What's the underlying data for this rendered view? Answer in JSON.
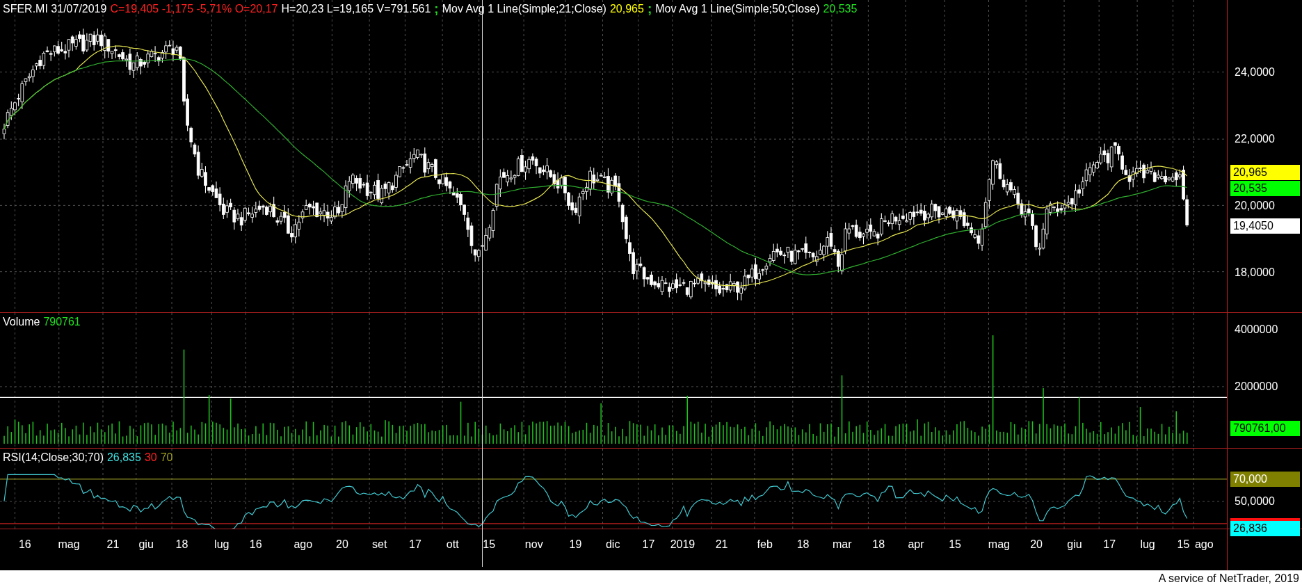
{
  "header": [
    {
      "text": "SFER.MI 31/07/2019",
      "color": "#ffffff"
    },
    {
      "text": "C=19,405 -1,175 -5,71% O=20,17",
      "color": "#ff2020"
    },
    {
      "text": "H=20,23 L=19,165 V=791.561",
      "color": "#ffffff"
    },
    {
      "text": ";",
      "color": "#20e020"
    },
    {
      "text": "Mov Avg 1 Line(Simple;21;Close)",
      "color": "#ffffff"
    },
    {
      "text": "20,965",
      "color": "#ffff00"
    },
    {
      "text": ";",
      "color": "#20e020"
    },
    {
      "text": "Mov Avg 1 Line(Simple;50;Close)",
      "color": "#ffffff"
    },
    {
      "text": "20,535",
      "color": "#20e020"
    }
  ],
  "price_axis": {
    "ticks": [
      "24,0000",
      "22,0000",
      "20,0000",
      "18,0000"
    ],
    "badges": [
      {
        "text": "20,965",
        "color": "#ffff00"
      },
      {
        "text": "20,535",
        "color": "#00ff00"
      },
      {
        "text": "19,4050",
        "color": "#ffffff"
      }
    ]
  },
  "volume_legend": [
    {
      "text": "Volume",
      "color": "#ffffff"
    },
    {
      "text": "790761",
      "color": "#20e020"
    }
  ],
  "volume_axis": {
    "ticks": [
      "4000000",
      "2000000"
    ],
    "badges": [
      {
        "text": "790761,00",
        "color": "#00ff00"
      }
    ]
  },
  "rsi_legend": [
    {
      "text": "RSI(14;Close;30;70)",
      "color": "#ffffff"
    },
    {
      "text": "26,835",
      "color": "#40e0e0"
    },
    {
      "text": "30",
      "color": "#ff2020"
    },
    {
      "text": "70",
      "color": "#a0a020"
    }
  ],
  "rsi_axis": {
    "ticks": [
      "50,0000"
    ],
    "badges": [
      {
        "text": "70,000",
        "color": "#808000"
      },
      {
        "text": "26,836",
        "color": "#00ffff"
      }
    ]
  },
  "time_axis": [
    "16",
    "mag",
    "21",
    "giu",
    "18",
    "lug",
    "16",
    "ago",
    "20",
    "set",
    "17",
    "ott",
    "15",
    "nov",
    "19",
    "dic",
    "17",
    "2019",
    "21",
    "feb",
    "18",
    "mar",
    "18",
    "apr",
    "15",
    "mag",
    "20",
    "giu",
    "17",
    "lug",
    "15",
    "ago"
  ],
  "footer": "A service of NetTrader, 2019"
}
